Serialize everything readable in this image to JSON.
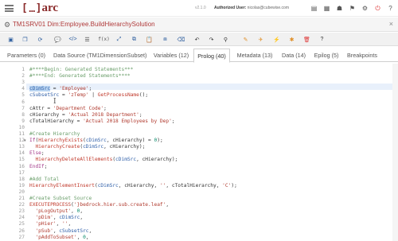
{
  "header": {
    "logo_left": "[",
    "logo_dots": "...",
    "logo_right": "]",
    "logo_text": "arc",
    "version": "v2.1.0",
    "auth_label": "Authorized User:",
    "auth_user": "nicolas@cubewise.com"
  },
  "titlebar": {
    "title": "TM1SRV01 Dim:Employee.BuildHierarchySolution",
    "close": "×"
  },
  "tabs": [
    {
      "label": "Parameters (0)"
    },
    {
      "label": "Data Source  (TM1DimensionSubset)"
    },
    {
      "label": "Variables (12)"
    },
    {
      "label": "Prolog (40)"
    },
    {
      "label": "Metadata (13)"
    },
    {
      "label": "Data (14)"
    },
    {
      "label": "Epilog (5)"
    },
    {
      "label": "Breakpoints"
    }
  ],
  "editor": {
    "line_numbers": [
      "1",
      "2",
      "3",
      "4",
      "5",
      "6",
      "7",
      "8",
      "9",
      "10",
      "11",
      "12",
      "13",
      "14",
      "15",
      "16",
      "17",
      "18",
      "19",
      "20",
      "21",
      "22",
      "23",
      "24",
      "25",
      "26",
      "27"
    ]
  },
  "colors": {
    "accent": "#b03a3a",
    "toolbar_icon": "#2f5f9f",
    "selected_line": "#e8f0fb"
  }
}
